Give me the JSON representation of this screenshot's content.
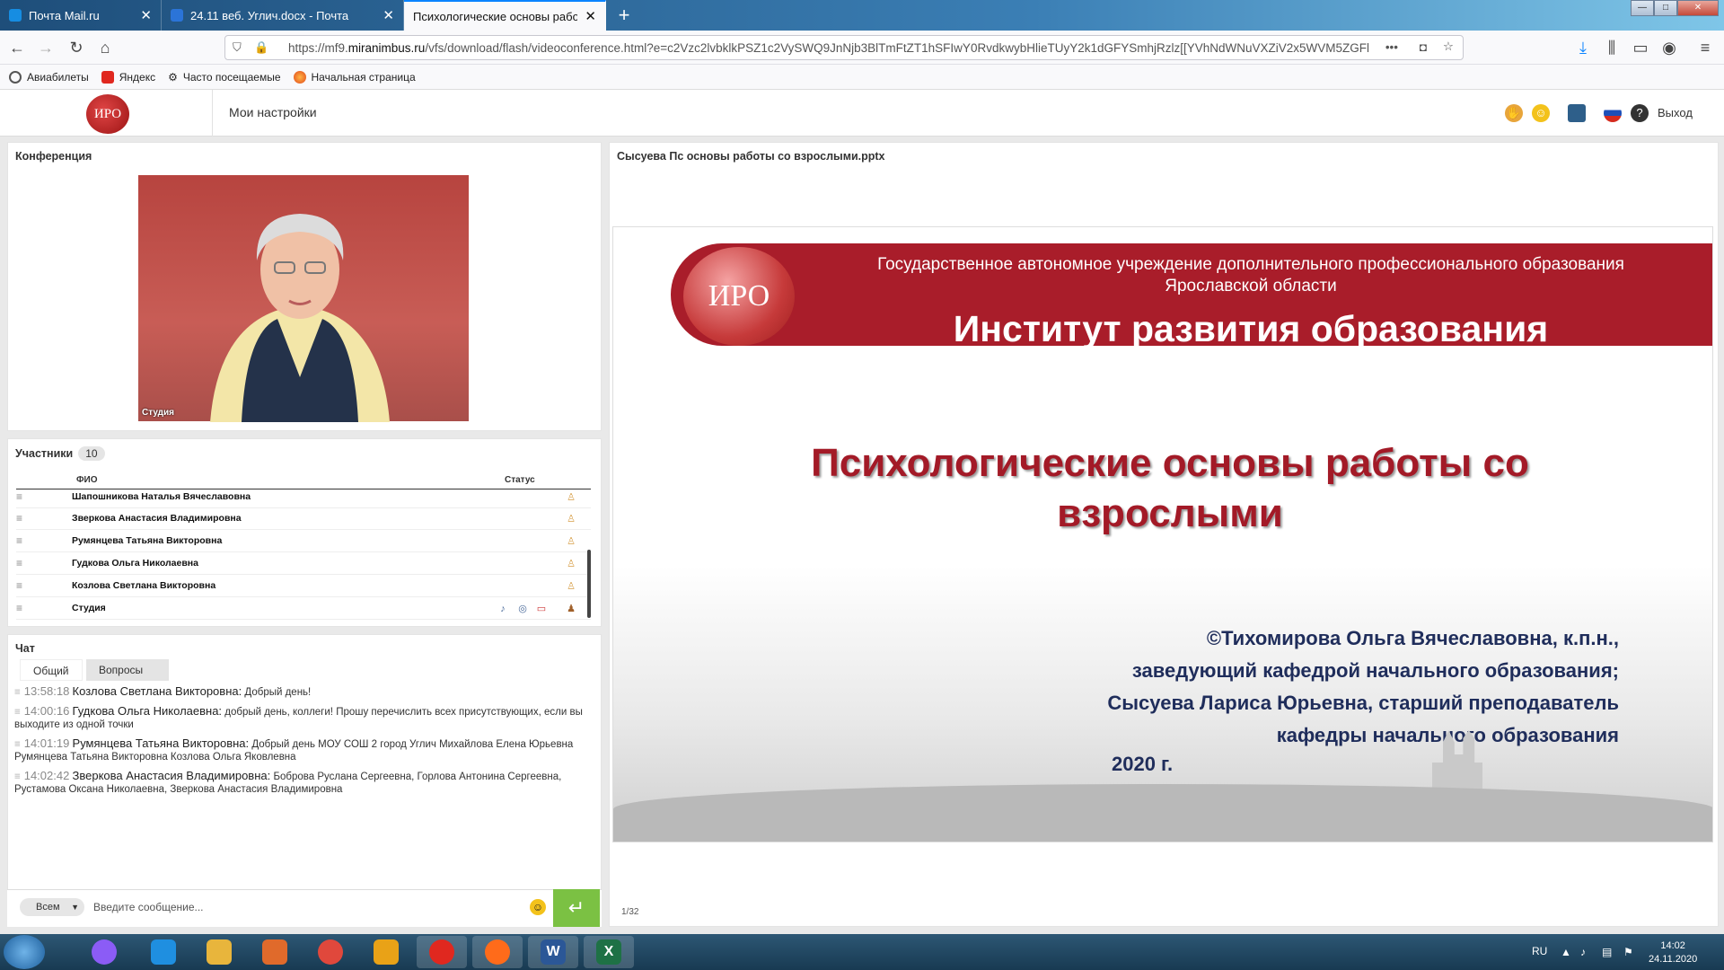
{
  "browser": {
    "tabs": [
      {
        "title": "Почта Mail.ru",
        "color": "#168de2"
      },
      {
        "title": "24.11 веб. Углич.docx - Почта",
        "color": "#2b74d8"
      },
      {
        "title": "Психологические основы работы",
        "color": "#2b74d8"
      }
    ],
    "new_tab": "+",
    "url_prefix": "https://mf9.",
    "url_domain": "miranimbus.ru",
    "url_rest": "/vfs/download/flash/videoconference.html?e=c2Vzc2lvbklkPSZ1c2VySWQ9JnNjb3BlTmFtZT1hSFIwY0RvdkwybHlieTUyY2k1dGFYSmhjRzlz[[YVhNdWNuVXZiV2x5WVM5ZGFl",
    "url_more": "•••",
    "bookmarks": [
      "Авиабилеты",
      "Яндекс",
      "Часто посещаемые",
      "Начальная страница"
    ]
  },
  "app": {
    "settings_label": "Мои настройки",
    "exit_label": "Выход",
    "logo_text": "ИРО"
  },
  "conference": {
    "title": "Конференция",
    "video_label": "Студия"
  },
  "participants": {
    "title": "Участники",
    "count": "10",
    "col_name": "ФИО",
    "col_status": "Статус",
    "rows": [
      {
        "name": "Шапошникова  Наталья  Вячеславовна"
      },
      {
        "name": "Зверкова Анастасия  Владимировна"
      },
      {
        "name": "Румянцева Татьяна  Викторовна"
      },
      {
        "name": "Гудкова  Ольга   Николаевна"
      },
      {
        "name": "Козлова  Светлана  Викторовна"
      },
      {
        "name": "Студия"
      }
    ]
  },
  "chat": {
    "title": "Чат",
    "tabs": [
      "Общий",
      "Вопросы"
    ],
    "messages": [
      {
        "time": "13:58:18",
        "user": "Козлова   Светлана   Викторовна:",
        "text": "Добрый день!"
      },
      {
        "time": "14:00:16",
        "user": "Гудкова   Ольга    Николаевна:",
        "text": "добрый день, коллеги! Прошу перечислить всех присутствующих, если вы выходите из одной точки"
      },
      {
        "time": "14:01:19",
        "user": "Румянцева Татьяна  Викторовна:",
        "text": "Добрый день МОУ СОШ 2 город Углич Михайлова Елена Юрьевна Румянцева Татьяна Викторовна Козлова Ольга Яковлевна"
      },
      {
        "time": "14:02:42",
        "user": "Зверкова Анастасия  Владимировна:",
        "text": "Боброва Руслана Сергеевна, Горлова Антонина Сергеевна, Рустамова Оксана Николаевна, Зверкова Анастасия Владимировна"
      }
    ],
    "recipient": "Всем",
    "placeholder": "Введите сообщение..."
  },
  "presentation": {
    "file": "Сысуева Пс основы работы со взрослыми.pptx",
    "logo_text": "ИРО",
    "org_line1": "Государственное автономное учреждение дополнительного профессионального образования",
    "org_line2": "Ярославской области",
    "org_name": "Институт развития образования",
    "title_line1": "Психологические основы работы со",
    "title_line2": "взрослыми",
    "author1": "©Тихомирова Ольга Вячеславовна, к.п.н.,",
    "author2": "заведующий кафедрой начального образования;",
    "author3": "Сысуева Лариса Юрьевна, старший преподаватель",
    "author4": "кафедры начального образования",
    "year": "2020 г.",
    "page": "1/32"
  },
  "taskbar": {
    "lang": "RU",
    "time": "14:02",
    "date": "24.11.2020",
    "apps": [
      {
        "icon": "alice-icon",
        "color": "#8b5cf6"
      },
      {
        "icon": "ie-icon",
        "color": "#1f8fe0"
      },
      {
        "icon": "explorer-icon",
        "color": "#e8b53c"
      },
      {
        "icon": "media-player-icon",
        "color": "#e06a2b"
      },
      {
        "icon": "chrome-icon",
        "color": "#e0483c"
      },
      {
        "icon": "outlook-icon",
        "color": "#e9a217"
      },
      {
        "icon": "yandex-icon",
        "color": "#e0281f"
      },
      {
        "icon": "firefox-icon",
        "color": "#ff6b1a"
      },
      {
        "icon": "word-icon",
        "color": "#2b5797",
        "letter": "W"
      },
      {
        "icon": "excel-icon",
        "color": "#1e7145",
        "letter": "X"
      }
    ]
  }
}
